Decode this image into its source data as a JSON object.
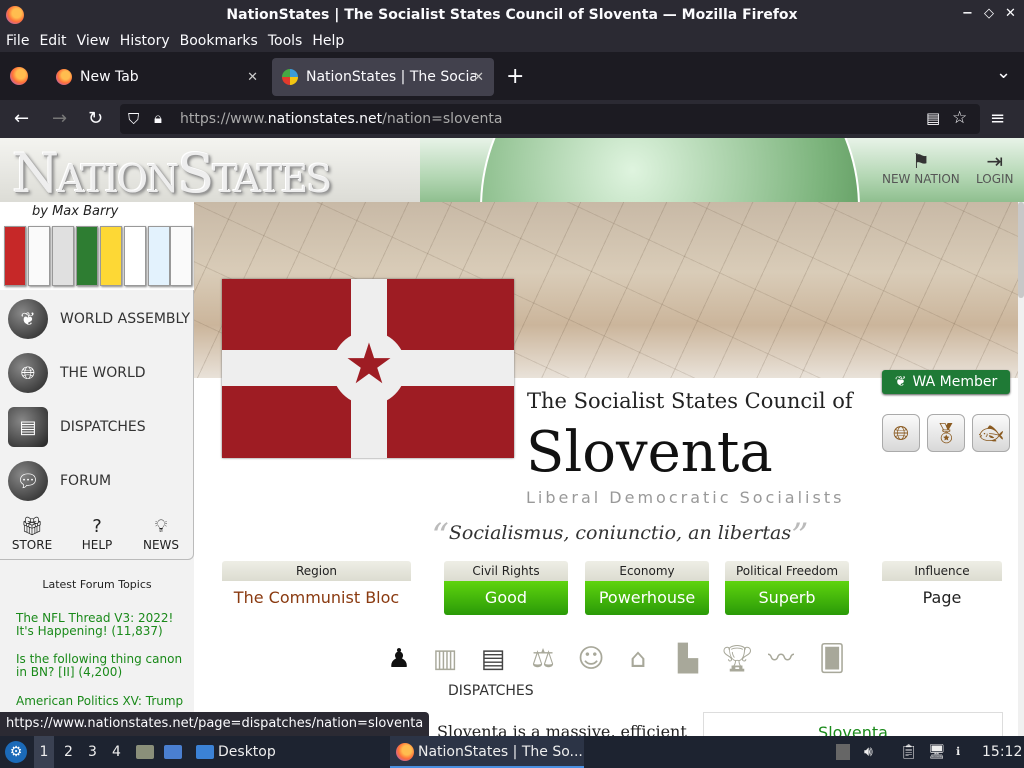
{
  "window": {
    "title": "NationStates | The Socialist States Council of Sloventa — Mozilla Firefox",
    "controls": [
      "−",
      "◇",
      "✕"
    ]
  },
  "menubar": {
    "items": [
      "File",
      "Edit",
      "View",
      "History",
      "Bookmarks",
      "Tools",
      "Help"
    ]
  },
  "tabs": [
    {
      "label": "New Tab",
      "close": "✕"
    },
    {
      "label": "NationStates | The Social",
      "close": "✕"
    }
  ],
  "tabbar": {
    "new_tab": "+",
    "list_tabs": "⌄"
  },
  "url": {
    "prefix": "https://www.",
    "domain": "nationstates.net",
    "path": "/nation=sloventa"
  },
  "header": {
    "logo": "NationStates",
    "new_nation": "NEW NATION",
    "login": "LOGIN"
  },
  "sidebar": {
    "by": "by Max Barry",
    "menu": [
      "WORLD ASSEMBLY",
      "THE WORLD",
      "DISPATCHES",
      "FORUM"
    ],
    "buttons": [
      "STORE",
      "HELP",
      "NEWS"
    ],
    "forum_heading": "Latest Forum Topics",
    "topics": [
      "The NFL Thread V3: 2022! It's Happening! (11,837)",
      "Is the following thing canon in BN? [II] (4,200)",
      "American Politics XV: Trump"
    ]
  },
  "nation": {
    "wa_badge": "WA Member",
    "prefix": "The Socialist States Council of",
    "name": "Sloventa",
    "category": "Liberal Democratic Socialists",
    "motto": "Socialismus, coniunctio, an libertas",
    "stats": [
      {
        "label": "Region",
        "value": "The Communist Bloc"
      },
      {
        "label": "Civil Rights",
        "value": "Good"
      },
      {
        "label": "Economy",
        "value": "Powerhouse"
      },
      {
        "label": "Political Freedom",
        "value": "Superb"
      },
      {
        "label": "Influence",
        "value": "Page"
      }
    ],
    "dispatches_label": "DISPATCHES",
    "description_start": "Sloventa is a massive, efficient",
    "sidebox_title": "Sloventa"
  },
  "statusbar": {
    "url": "https://www.nationstates.net/page=dispatches/nation=sloventa"
  },
  "taskbar": {
    "workspaces": [
      "1",
      "2",
      "3",
      "4"
    ],
    "desktop": "Desktop",
    "app": "NationStates | The So...",
    "clock": "15:12"
  },
  "colors": {
    "accent_green": "#1a8a1a",
    "stat_green": "#3fb40b",
    "flag_red": "#9e1c23"
  }
}
